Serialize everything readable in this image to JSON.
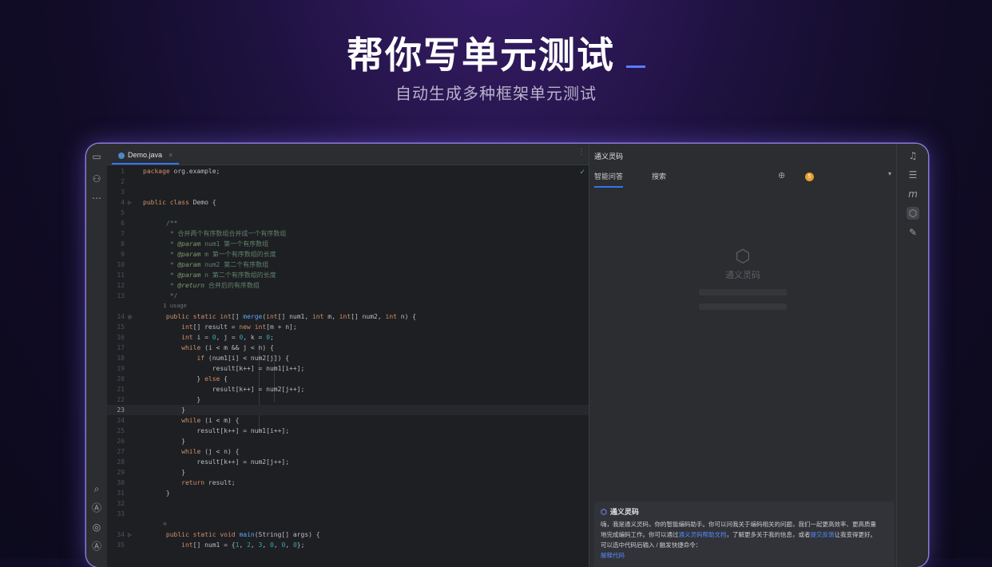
{
  "hero": {
    "title": "帮你写单元测试",
    "subtitle": "自动生成多种框架单元测试"
  },
  "editor": {
    "tab_label": "Demo.java",
    "current_line": "23"
  },
  "panel": {
    "title": "通义灵码",
    "tabs": [
      "智能问答",
      "搜索"
    ],
    "badge_count": "5",
    "logo_name": "通义灵码",
    "chat": {
      "sender": "通义灵码",
      "line1": "嗨，我是通义灵码，你的智能编码助手。你可以问我关于编码相关的问题，我们一起更高效率、更高质量",
      "line2_a": "地完成编码工作。你可以通过",
      "line2_link": "通义灵码帮助文档",
      "line2_b": "，了解更多关于我的信息，或者",
      "line2_link2": "提交反馈",
      "line2_c": "让我变得更好。",
      "line3": "可以选中代码后输入 / 触发快捷命令：",
      "line4_link": "解释代码"
    }
  },
  "icons": {
    "left_rail": [
      "folder-icon",
      "structure-icon",
      "more-icon",
      "search-icon",
      "ai-icon",
      "run-icon",
      "ai-alt-icon"
    ],
    "right_rail": [
      "bell-icon",
      "database-icon",
      "maven-icon",
      "tongyi-icon",
      "notes-icon"
    ]
  },
  "colors": {
    "accent": "#3574f0",
    "keyword": "#cf8e6d",
    "function": "#56a8f5",
    "number": "#2aacb8",
    "comment": "#5f826b"
  }
}
